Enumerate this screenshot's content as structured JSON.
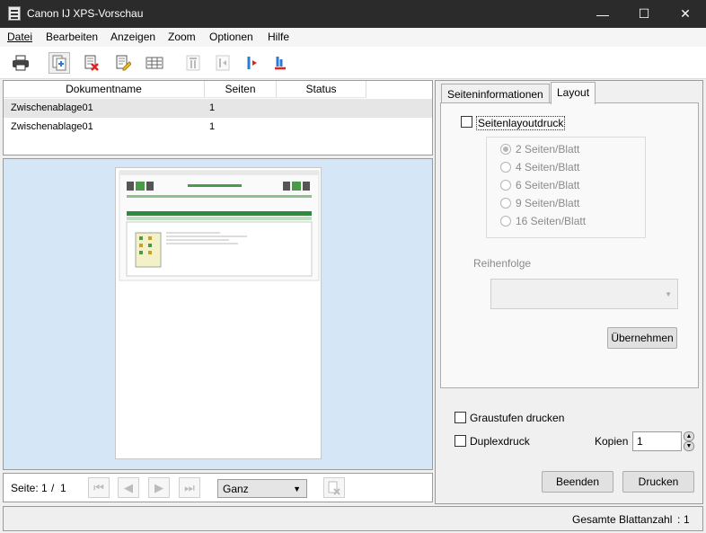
{
  "window": {
    "title": "Canon IJ XPS-Vorschau",
    "minimize": "—",
    "maximize": "☐",
    "close": "✕"
  },
  "menu": [
    "Datei",
    "Bearbeiten",
    "Anzeigen",
    "Zoom",
    "Optionen",
    "Hilfe"
  ],
  "doclist": {
    "headers": {
      "name": "Dokumentname",
      "pages": "Seiten",
      "status": "Status"
    },
    "rows": [
      {
        "name": "Zwischenablage01",
        "pages": "1",
        "status": ""
      },
      {
        "name": "Zwischenablage01",
        "pages": "1",
        "status": ""
      }
    ]
  },
  "pagenav": {
    "label": "Seite:",
    "current": "1",
    "sep": "/",
    "total": "1",
    "zoom": "Ganz"
  },
  "tabs": {
    "info": "Seiteninformationen",
    "layout": "Layout"
  },
  "layout": {
    "checkbox": "Seitenlayoutdruck",
    "options": [
      "2 Seiten/Blatt",
      "4 Seiten/Blatt",
      "6 Seiten/Blatt",
      "9 Seiten/Blatt",
      "16 Seiten/Blatt"
    ],
    "order_label": "Reihenfolge",
    "apply": "Übernehmen"
  },
  "options": {
    "grayscale": "Graustufen drucken",
    "duplex": "Duplexdruck",
    "copies_label": "Kopien",
    "copies_value": "1"
  },
  "buttons": {
    "close": "Beenden",
    "print": "Drucken"
  },
  "status": {
    "total_label": "Gesamte Blattanzahl",
    "sep": ":",
    "total": "1"
  },
  "colors": {
    "titlebar": "#2b2b2b",
    "preview_bg": "#d5e6f7",
    "selected_row": "#e6e6e6"
  }
}
